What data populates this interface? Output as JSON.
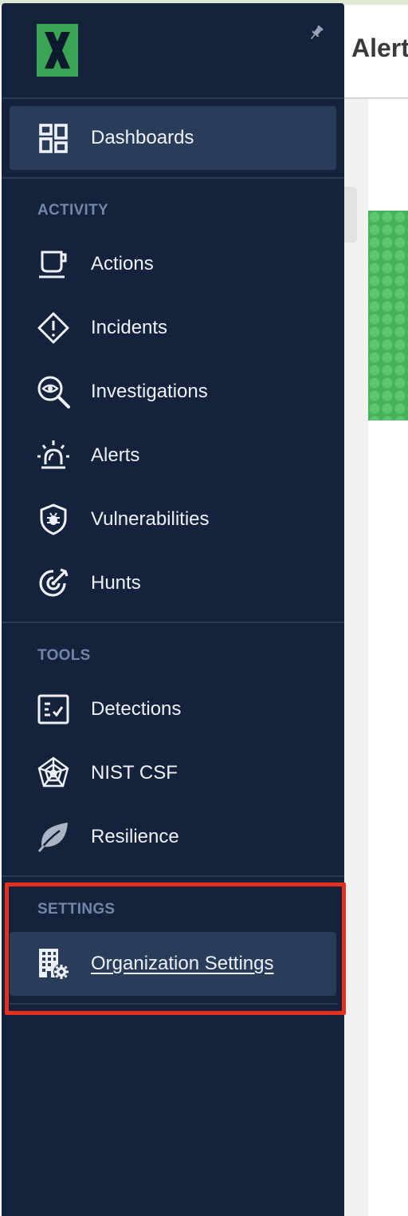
{
  "page": {
    "header_title": "Alerts"
  },
  "colors": {
    "sidebar_bg": "#15223b",
    "active_item_bg": "#293d5b",
    "section_label": "#7186a8",
    "logo_green": "#3aa655",
    "highlight_border": "#e3301f"
  },
  "sidebar": {
    "logo_icon": "x-logo-icon",
    "pin_icon": "pin-icon",
    "top_item": {
      "label": "Dashboards",
      "icon": "dashboard-grid-icon",
      "active": true
    },
    "sections": [
      {
        "title": "ACTIVITY",
        "items": [
          {
            "label": "Actions",
            "icon": "cup-icon"
          },
          {
            "label": "Incidents",
            "icon": "warning-diamond-icon"
          },
          {
            "label": "Investigations",
            "icon": "magnifier-eye-icon"
          },
          {
            "label": "Alerts",
            "icon": "siren-icon"
          },
          {
            "label": "Vulnerabilities",
            "icon": "shield-bug-icon"
          },
          {
            "label": "Hunts",
            "icon": "target-icon"
          }
        ]
      },
      {
        "title": "TOOLS",
        "items": [
          {
            "label": "Detections",
            "icon": "checklist-icon"
          },
          {
            "label": "NIST CSF",
            "icon": "spiderweb-icon"
          },
          {
            "label": "Resilience",
            "icon": "leaf-icon"
          }
        ]
      },
      {
        "title": "SETTINGS",
        "items": [
          {
            "label": "Organization Settings",
            "icon": "building-gear-icon",
            "active": true
          }
        ]
      }
    ]
  }
}
